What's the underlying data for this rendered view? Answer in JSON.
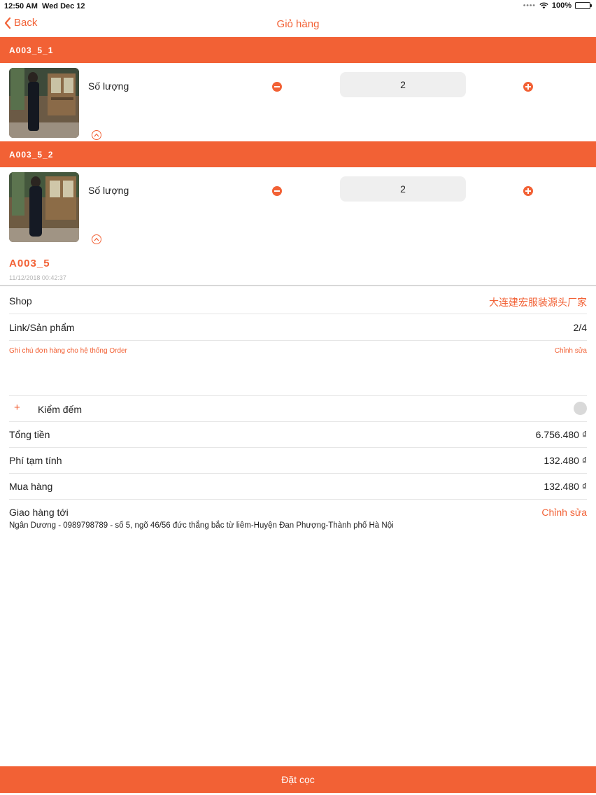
{
  "status_bar": {
    "time": "12:50 AM",
    "date": "Wed Dec 12",
    "battery": "100%"
  },
  "nav": {
    "back_label": "Back",
    "title": "Giỏ hàng"
  },
  "items": [
    {
      "code": "A003_5_1",
      "qty_label": "Số lượng",
      "qty": "2"
    },
    {
      "code": "A003_5_2",
      "qty_label": "Số lượng",
      "qty": "2"
    }
  ],
  "order": {
    "code": "A003_5",
    "date": "11/12/2018 00:42:37"
  },
  "info": {
    "shop_label": "Shop",
    "shop_value": "大连建宏服装源头厂家",
    "link_label": "Link/Sản phẩm",
    "link_value": "2/4",
    "note_label": "Ghi chú đơn hàng cho hệ thống Order",
    "note_edit": "Chỉnh sửa",
    "check_plus": "+",
    "check_label": "Kiểm đếm",
    "total_label": "Tổng tiền",
    "total_value": "6.756.480 ₫",
    "fee_label": "Phí tạm tính",
    "fee_value": "132.480 ₫",
    "purchase_label": "Mua hàng",
    "purchase_value": "132.480 ₫"
  },
  "delivery": {
    "label": "Giao hàng tới",
    "edit": "Chỉnh sửa",
    "address": "Ngân Dương - 0989798789 - số 5, ngõ 46/56 đức thắng bắc từ liêm-Huyện Đan Phượng-Thành phố Hà Nội"
  },
  "footer": {
    "button": "Đặt cọc"
  },
  "colors": {
    "accent": "#f26135",
    "field_bg": "#efefef"
  }
}
